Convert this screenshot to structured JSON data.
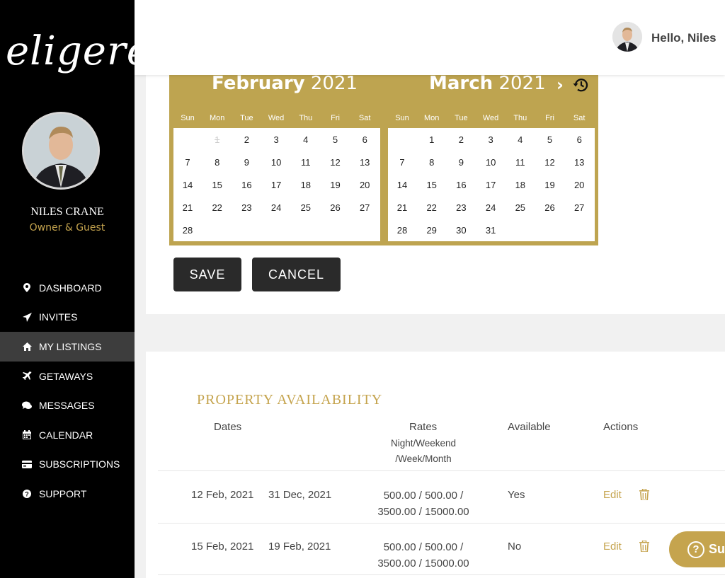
{
  "app": {
    "logo_text": "eligere"
  },
  "user": {
    "name": "NILES CRANE",
    "role": "Owner & Guest",
    "greeting": "Hello, Niles"
  },
  "sidebar": {
    "items": [
      {
        "label": "DASHBOARD",
        "icon": "map-marker-icon"
      },
      {
        "label": "INVITES",
        "icon": "paper-plane-icon"
      },
      {
        "label": "MY LISTINGS",
        "icon": "home-icon",
        "active": true
      },
      {
        "label": "GETAWAYS",
        "icon": "plane-icon"
      },
      {
        "label": "MESSAGES",
        "icon": "chat-icon"
      },
      {
        "label": "CALENDAR",
        "icon": "calendar-icon"
      },
      {
        "label": "SUBSCRIPTIONS",
        "icon": "credit-card-icon"
      },
      {
        "label": "SUPPORT",
        "icon": "question-circle-icon"
      }
    ]
  },
  "calendar": {
    "months": [
      {
        "month": "February",
        "year": "2021",
        "dow": [
          "Sun",
          "Mon",
          "Tue",
          "Wed",
          "Thu",
          "Fri",
          "Sat"
        ],
        "first_weekday": 1,
        "days": 28,
        "disabled": [
          1
        ]
      },
      {
        "month": "March",
        "year": "2021",
        "dow": [
          "Sun",
          "Mon",
          "Tue",
          "Wed",
          "Thu",
          "Fri",
          "Sat"
        ],
        "first_weekday": 1,
        "days": 31,
        "disabled": []
      }
    ]
  },
  "buttons": {
    "save": "SAVE",
    "cancel": "CANCEL"
  },
  "availability": {
    "title": "PROPERTY AVAILABILITY",
    "headers": {
      "dates": "Dates",
      "rates": "Rates",
      "rates_sub1": "Night/Weekend",
      "rates_sub2": "/Week/Month",
      "available": "Available",
      "actions": "Actions"
    },
    "rows": [
      {
        "start": "12 Feb, 2021",
        "end": "31 Dec, 2021",
        "rates1": "500.00 / 500.00 /",
        "rates2": "3500.00 / 15000.00",
        "available": "Yes",
        "edit": "Edit"
      },
      {
        "start": "15 Feb, 2021",
        "end": "19 Feb, 2021",
        "rates1": "500.00 / 500.00 /",
        "rates2": "3500.00 / 15000.00",
        "available": "No",
        "edit": "Edit"
      }
    ]
  },
  "support": {
    "label": "Sup"
  },
  "colors": {
    "accent": "#c5a44e",
    "calendar_bg": "#bea450",
    "sidebar_bg": "#000000",
    "active_bg": "#3d3d3d"
  }
}
